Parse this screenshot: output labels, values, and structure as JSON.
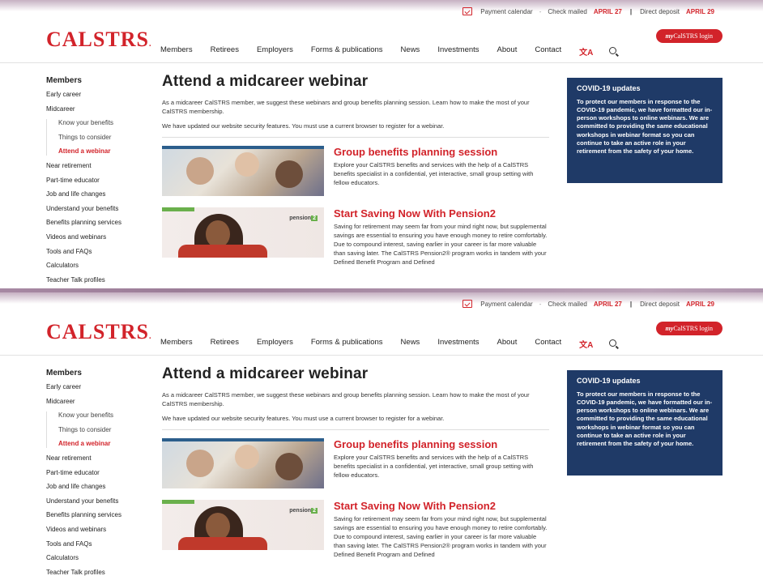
{
  "topbar": {
    "payment_calendar": "Payment calendar",
    "dash": "-",
    "check_mailed": "Check mailed",
    "check_date": "APRIL 27",
    "pipe": "|",
    "direct_deposit": "Direct deposit",
    "deposit_date": "APRIL 29"
  },
  "header": {
    "logo": "CALSTRS",
    "logo_dot": ".",
    "login_my": "my",
    "login_rest": "CalSTRS login",
    "nav": [
      "Members",
      "Retirees",
      "Employers",
      "Forms & publications",
      "News",
      "Investments",
      "About",
      "Contact"
    ],
    "lang_icon": "文A"
  },
  "sidenav": {
    "title": "Members",
    "items_before": [
      "Early career",
      "Midcareer"
    ],
    "sub_items": [
      "Know your benefits",
      "Things to consider",
      "Attend a webinar"
    ],
    "items_after": [
      "Near retirement",
      "Part-time educator",
      "Job and life changes",
      "Understand your benefits",
      "Benefits planning services",
      "Videos and webinars",
      "Tools and FAQs",
      "Calculators",
      "Teacher Talk profiles"
    ]
  },
  "main": {
    "title": "Attend a midcareer webinar",
    "intro": "As a midcareer CalSTRS member, we suggest these webinars and group benefits planning session. Learn how to make the most of your CalSTRS membership.",
    "security": "We have updated our website security features. You must use a current browser to register for a webinar.",
    "card1_title": "Group benefits planning session",
    "card1_desc": "Explore your CalSTRS benefits and services with the help of a CalSTRS benefits specialist in a confidential, yet interactive, small group setting with fellow educators.",
    "card2_title": "Start Saving Now With Pension2",
    "card2_desc": "Saving for retirement may seem far from your mind right now, but supplemental savings are essential to ensuring you have enough money to retire comfortably. Due to compound interest, saving earlier in your career is far more valuable than saving later. The CalSTRS Pension2® program works in tandem with your Defined Benefit Program and Defined",
    "pension2_logo_text": "pension",
    "pension2_logo_two": "2"
  },
  "covid": {
    "title": "COVID-19 updates",
    "text": "To protect our members in response to the COVID-19 pandemic, we have formatted our in-person workshops to online webinars. We are committed to providing the same educational workshops in webinar format so you can continue to take an active role in your retirement from the safety of your home."
  },
  "colors": {
    "brand_red": "#d2232a",
    "covid_navy": "#1f3a67"
  }
}
